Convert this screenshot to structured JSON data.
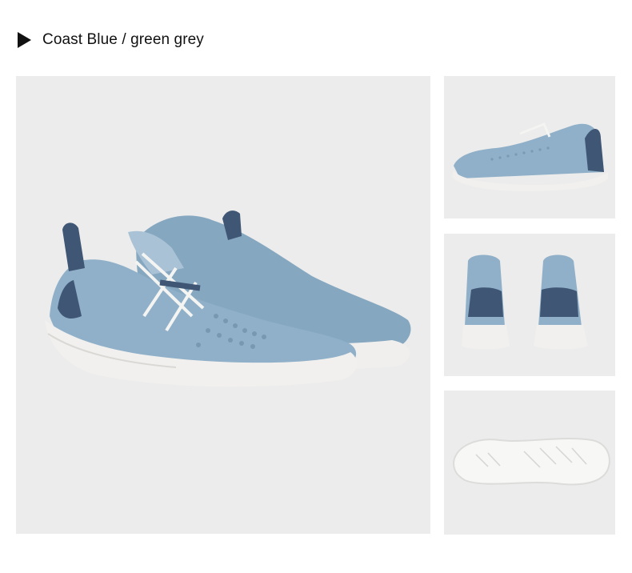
{
  "header": {
    "title": "Coast Blue / green grey",
    "marker_icon": "play-triangle-icon"
  },
  "colors": {
    "background": "#ffffff",
    "photo_backdrop": "#ececec",
    "upper_blue": "#8fb0c8",
    "navy_accent": "#3f5675",
    "sole_white": "#f1f0ee",
    "lace_white": "#f4f4f2",
    "text": "#111111"
  },
  "images": [
    {
      "id": "main",
      "subject": "pair of sneakers, three-quarter view"
    },
    {
      "id": "side",
      "subject": "single sneaker, side profile"
    },
    {
      "id": "back",
      "subject": "pair of sneakers, heel view"
    },
    {
      "id": "sole",
      "subject": "outsole, bottom view"
    }
  ]
}
